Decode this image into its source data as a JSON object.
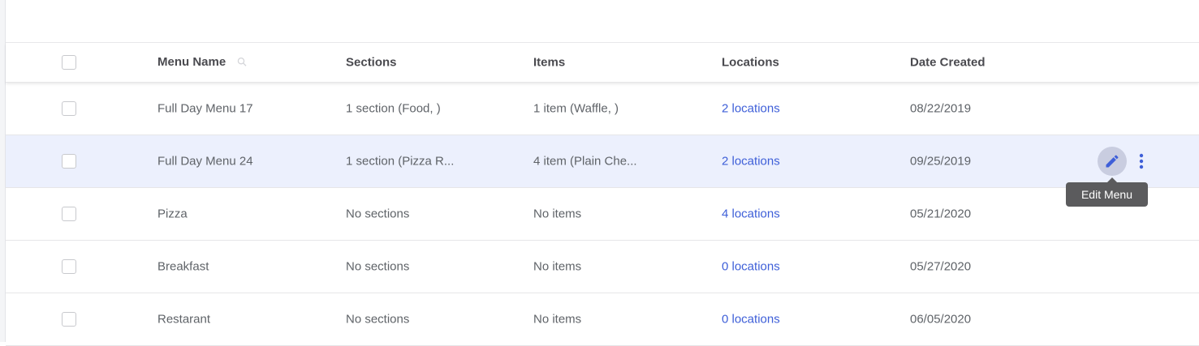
{
  "colors": {
    "accent_link": "#3e5fd8",
    "hover_row": "#ecf0fd",
    "tooltip_bg": "#5b5b5d",
    "edit_icon": "#3e5fd8"
  },
  "table": {
    "headers": {
      "menu_name": "Menu Name",
      "sections": "Sections",
      "items": "Items",
      "locations": "Locations",
      "date_created": "Date Created"
    },
    "rows": [
      {
        "name": "Full Day Menu 17",
        "sections": "1 section (Food, )",
        "items": "1 item (Waffle, )",
        "locations": "2 locations",
        "date": "08/22/2019"
      },
      {
        "name": "Full Day Menu 24",
        "sections": "1 section (Pizza R...",
        "items": "4 item (Plain Che...",
        "locations": "2 locations",
        "date": "09/25/2019"
      },
      {
        "name": "Pizza",
        "sections": "No sections",
        "items": "No items",
        "locations": "4 locations",
        "date": "05/21/2020"
      },
      {
        "name": "Breakfast",
        "sections": "No sections",
        "items": "No items",
        "locations": "0 locations",
        "date": "05/27/2020"
      },
      {
        "name": "Restarant",
        "sections": "No sections",
        "items": "No items",
        "locations": "0 locations",
        "date": "06/05/2020"
      }
    ]
  },
  "row_actions": {
    "edit_icon": "pencil-icon",
    "more_icon": "more-vertical-icon",
    "tooltip": "Edit Menu"
  }
}
